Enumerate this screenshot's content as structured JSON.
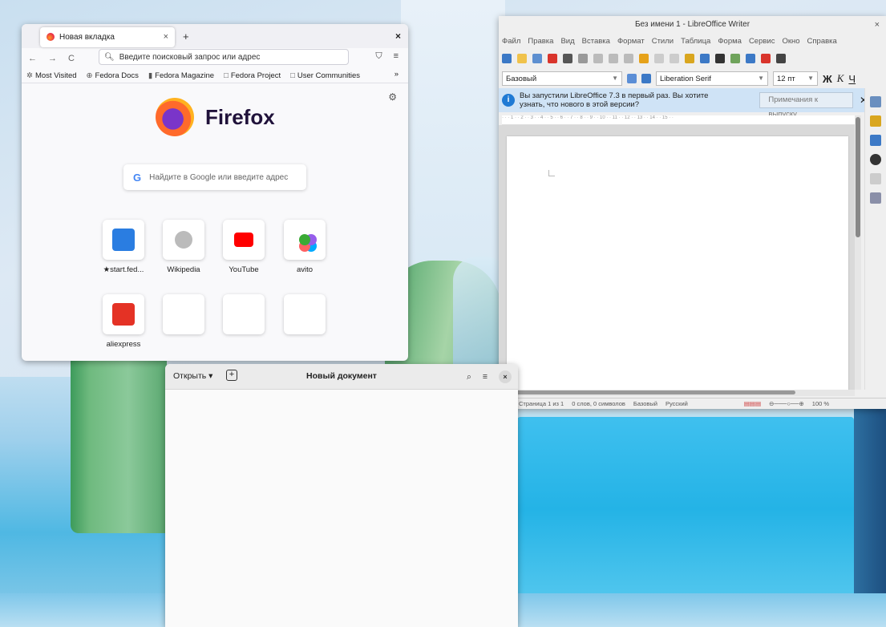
{
  "firefox": {
    "tab_title": "Новая вкладка",
    "tab_close": "×",
    "new_tab": "+",
    "window_close": "×",
    "nav_back": "←",
    "nav_forward": "→",
    "nav_reload": "C",
    "url_placeholder": "Введите поисковый запрос или адрес",
    "bookmarks": [
      {
        "icon": "gear-icon",
        "glyph": "✲",
        "label": "Most Visited"
      },
      {
        "icon": "globe-icon",
        "glyph": "⊕",
        "label": "Fedora Docs"
      },
      {
        "icon": "magazine-icon",
        "glyph": "▮",
        "label": "Fedora Magazine"
      },
      {
        "icon": "folder-icon",
        "glyph": "□",
        "label": "Fedora Project"
      },
      {
        "icon": "folder-icon",
        "glyph": "□",
        "label": "User Communities"
      }
    ],
    "bookmarks_more": "»",
    "logo_text": "Firefox",
    "search_placeholder": "Найдите в Google или введите адрес",
    "shortcuts": [
      {
        "label": "★start.fed...",
        "icon": "start-fedora-icon",
        "color": "#2a7de1"
      },
      {
        "label": "Wikipedia",
        "icon": "wikipedia-icon",
        "color": "#bbbbbb"
      },
      {
        "label": "YouTube",
        "icon": "youtube-icon",
        "color": "#ff0000"
      },
      {
        "label": "avito",
        "icon": "avito-icon",
        "color": "#3aaa35"
      },
      {
        "label": "aliexpress",
        "icon": "aliexpress-icon",
        "color": "#e43225"
      },
      {
        "label": "",
        "icon": "empty-tile",
        "color": ""
      },
      {
        "label": "",
        "icon": "empty-tile",
        "color": ""
      },
      {
        "label": "",
        "icon": "empty-tile",
        "color": ""
      }
    ]
  },
  "libreoffice": {
    "title": "Без имени 1 - LibreOffice Writer",
    "close": "×",
    "menu": [
      "Файл",
      "Правка",
      "Вид",
      "Вставка",
      "Формат",
      "Стили",
      "Таблица",
      "Форма",
      "Сервис",
      "Окно",
      "Справка"
    ],
    "style": "Базовый",
    "font": "Liberation Serif",
    "size": "12 пт",
    "bold": "Ж",
    "italic": "К",
    "underline": "Ч",
    "info_message": "Вы запустили LibreOffice 7.3 в первый раз. Вы хотите узнать, что нового в этой версии?",
    "info_button": "Примечания к выпуску",
    "info_close": "✕",
    "status": {
      "page": "Страница 1 из 1",
      "words": "0 слов, 0 символов",
      "style": "Базовый",
      "lang": "Русский",
      "zoom": "100 %"
    }
  },
  "gedit": {
    "open_label": "Открыть ▾",
    "new_icon": "+",
    "title": "Новый документ",
    "close": "×"
  }
}
